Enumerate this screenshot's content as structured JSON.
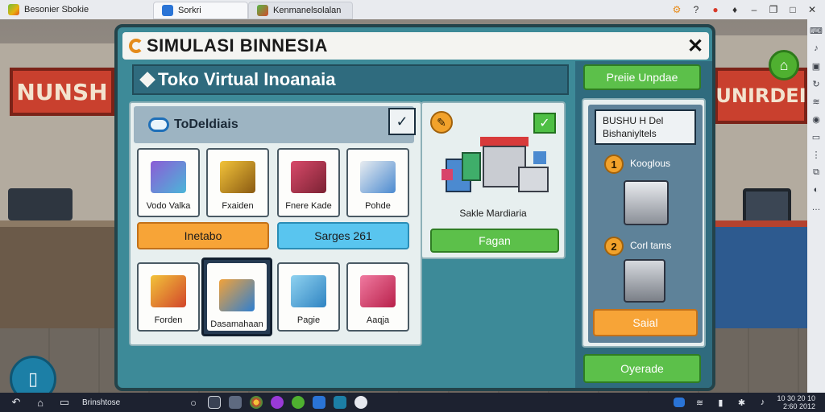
{
  "window": {
    "app_title": "Besonier Sbokie",
    "tabs": [
      {
        "label": "Sorkri"
      },
      {
        "label": "Kenmanelsolalan"
      }
    ],
    "controls": [
      "settings",
      "help",
      "record",
      "minimize",
      "restore",
      "maximize",
      "close"
    ]
  },
  "taskbar": {
    "label": "Brinshtose",
    "clock_time": "10 30 20 10",
    "clock_date": "2:60 2012"
  },
  "dialog": {
    "title": "SIMULASI BINNESIA",
    "store_title": "Toko Virtual Inoanaia",
    "category_label": "ToDeldiais",
    "items_row1": [
      {
        "label": "Vodo Valka",
        "color": "#8c5cd6"
      },
      {
        "label": "Fxaiden",
        "color": "#f2c33a"
      },
      {
        "label": "Fnere Kade",
        "color": "#d84a6a"
      },
      {
        "label": "Pohde",
        "color": "#4b8ad0"
      }
    ],
    "pill_left": "Inetabo",
    "pill_right": "Sarges 261",
    "items_row2": [
      {
        "label": "Forden",
        "color": "#f2c33a"
      },
      {
        "label": "Dasamahaan",
        "color": "#2e7fd1"
      },
      {
        "label": "Pagie",
        "color": "#5db3e6"
      },
      {
        "label": "Aaqja",
        "color": "#d8446a"
      }
    ],
    "shop_label": "Sakle Mardiaria",
    "shop_button": "Fagan",
    "top_button": "Preiie Unpdae",
    "info_line1": "BUSHU H Del",
    "info_line2": "Bishaniyltels",
    "step1": "Kooglous",
    "step2": "Corl tams",
    "sell_button": "Saial",
    "upgrade_button": "Oyerade"
  },
  "scene": {
    "sign_left": "NUNSH",
    "sign_right": "UNIRDEI"
  }
}
